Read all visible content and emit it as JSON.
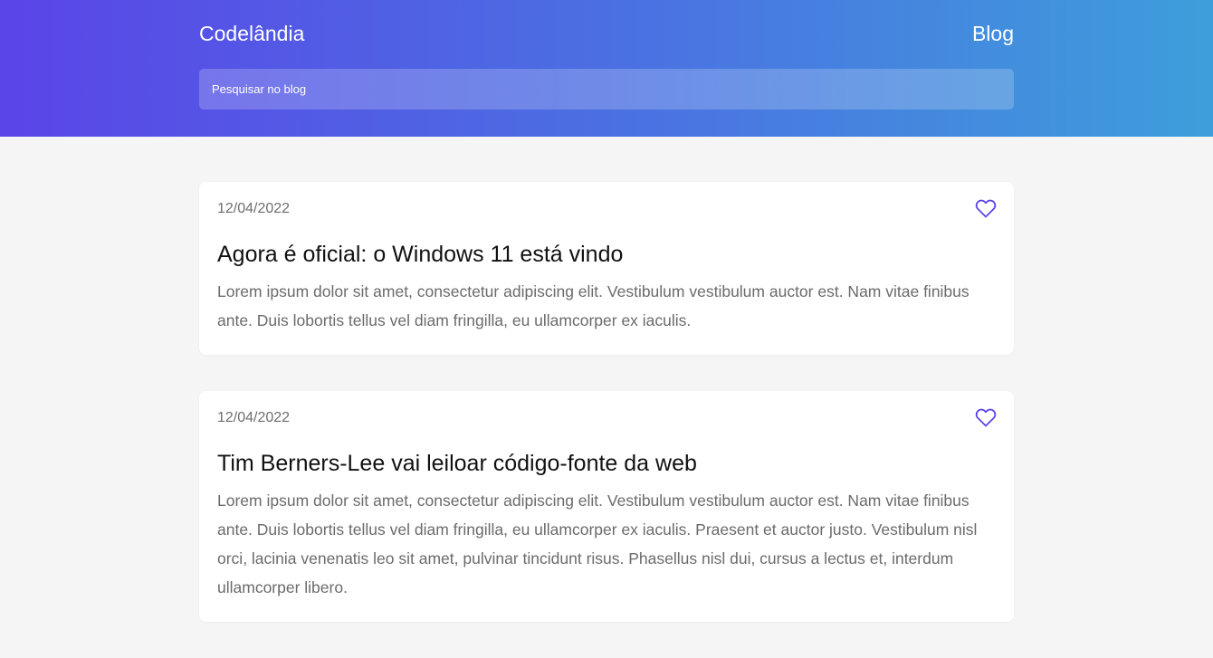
{
  "header": {
    "brand": "Codelândia",
    "nav_blog": "Blog",
    "search_placeholder": "Pesquisar no blog",
    "search_value": ""
  },
  "colors": {
    "gradient_start": "#5a45e8",
    "gradient_end": "#3e9edb",
    "accent": "#5a45e8",
    "page_bg": "#f5f5f5"
  },
  "posts": [
    {
      "date": "12/04/2022",
      "title": "Agora é oficial: o Windows 11 está vindo",
      "body": "Lorem ipsum dolor sit amet, consectetur adipiscing elit. Vestibulum vestibulum auctor est. Nam vitae finibus ante. Duis lobortis tellus vel diam fringilla, eu ullamcorper ex iaculis.",
      "like_icon": "heart-outline-icon"
    },
    {
      "date": "12/04/2022",
      "title": "Tim Berners-Lee vai leiloar código-fonte da web",
      "body": "Lorem ipsum dolor sit amet, consectetur adipiscing elit. Vestibulum vestibulum auctor est. Nam vitae finibus ante. Duis lobortis tellus vel diam fringilla, eu ullamcorper ex iaculis. Praesent et auctor justo. Vestibulum nisl orci, lacinia venenatis leo sit amet, pulvinar tincidunt risus. Phasellus nisl dui, cursus a lectus et, interdum ullamcorper libero.",
      "like_icon": "heart-outline-icon"
    }
  ]
}
